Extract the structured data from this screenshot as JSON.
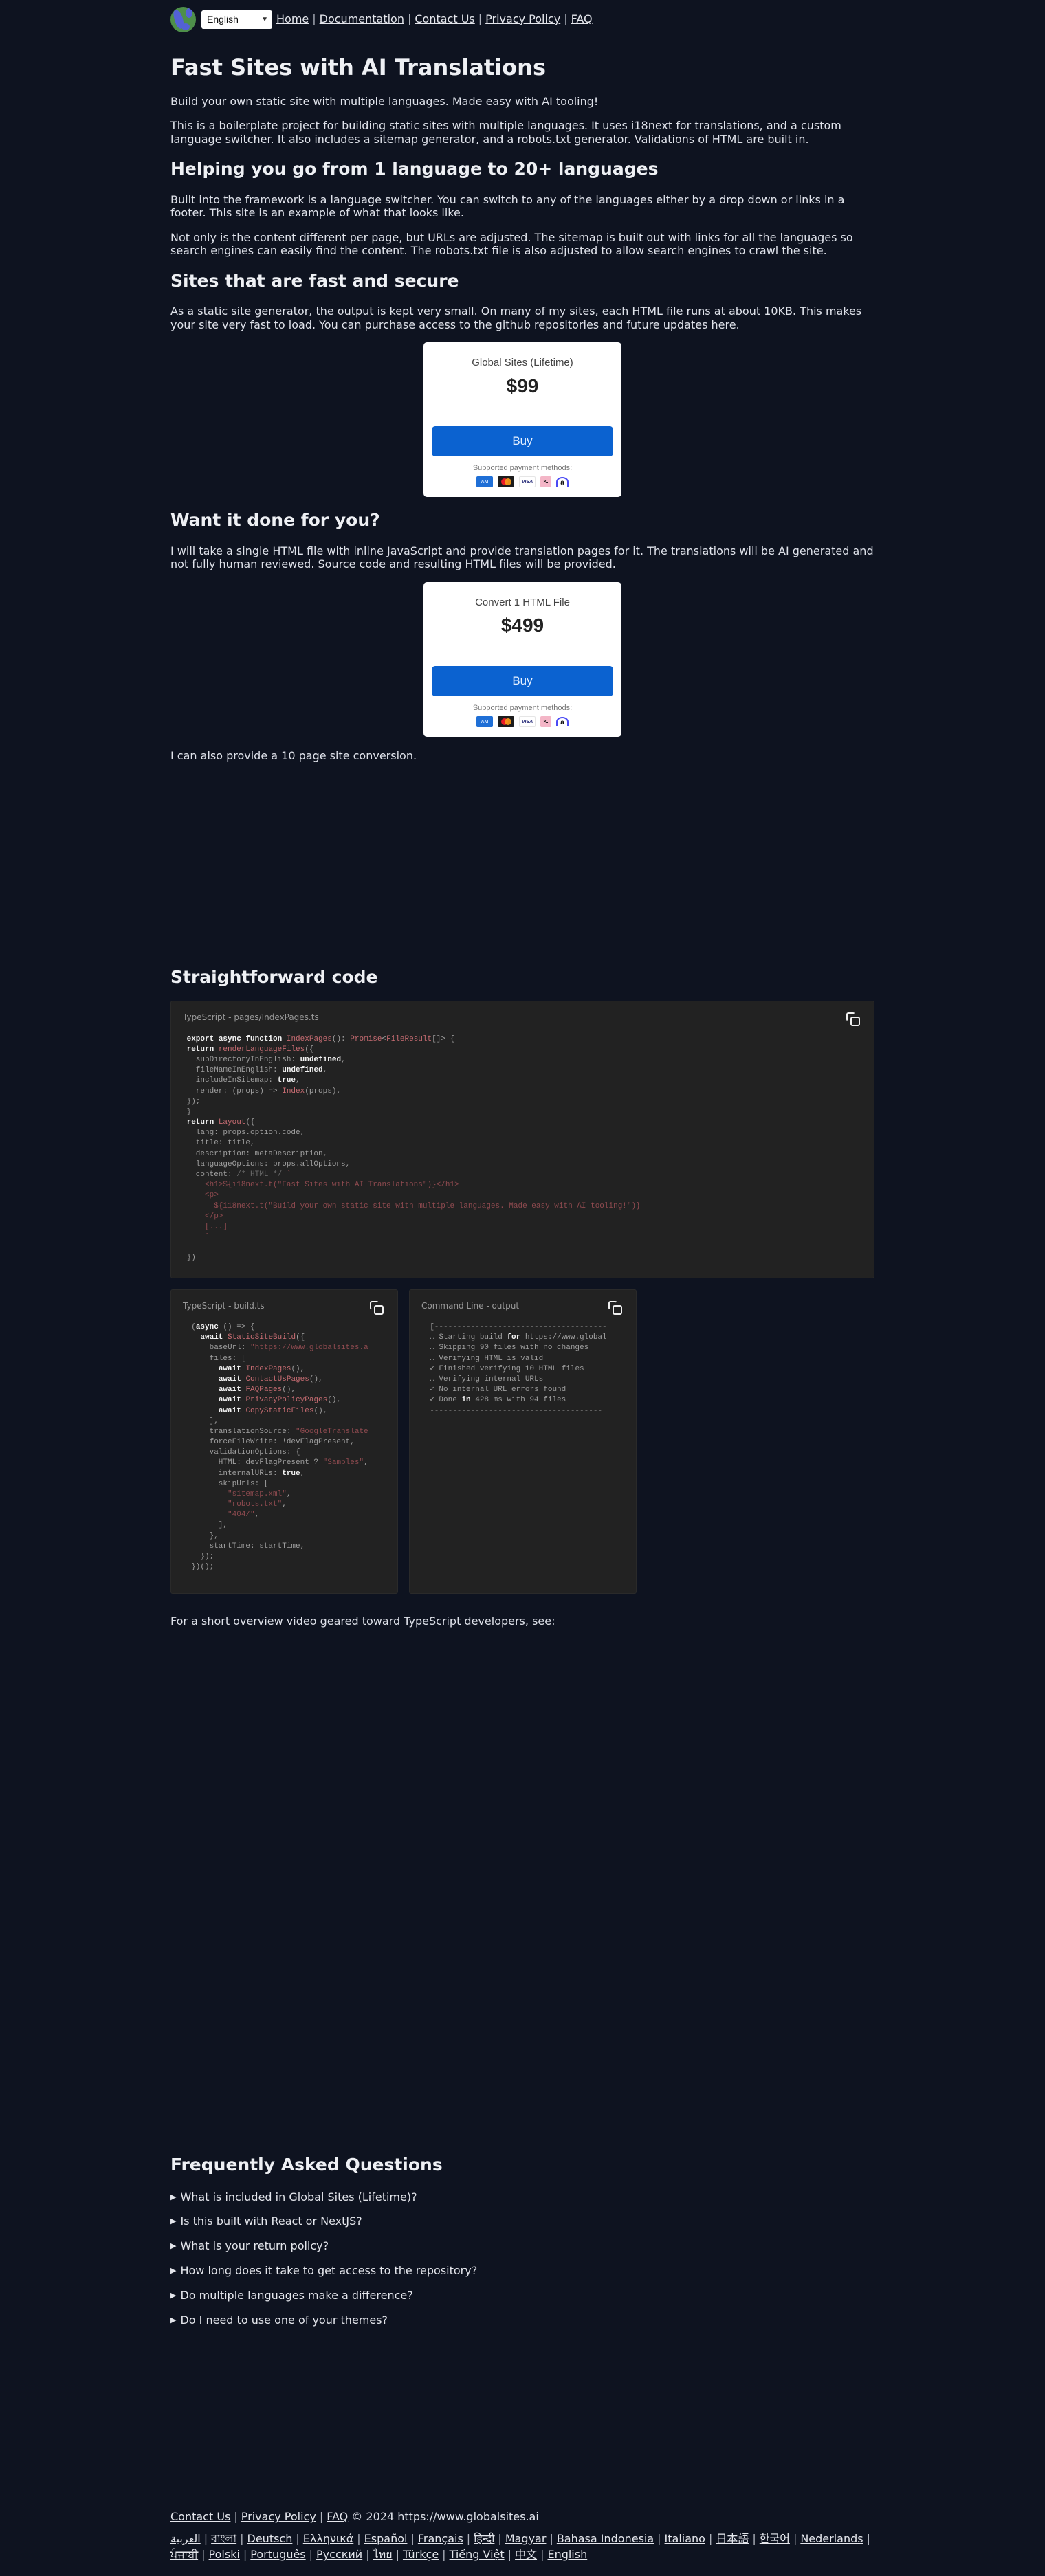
{
  "nav": {
    "globe_icon": "globe-icon",
    "language_select": {
      "value": "English",
      "icon": "chevron-down-icon"
    },
    "links": [
      "Home",
      "Documentation",
      "Contact Us",
      "Privacy Policy",
      "FAQ"
    ],
    "separator": "|"
  },
  "hero": {
    "title": "Fast Sites with AI Translations",
    "subtitle": "Build your own static site with multiple languages. Made easy with AI tooling!",
    "intro": "This is a boilerplate project for building static sites with multiple languages. It uses i18next for translations, and a custom language switcher. It also includes a sitemap generator, and a robots.txt generator. Validations of HTML are built in."
  },
  "languages_section": {
    "heading": "Helping you go from 1 language to 20+ languages",
    "p1": "Built into the framework is a language switcher. You can switch to any of the languages either by a drop down or links in a footer. This site is an example of what that looks like.",
    "p2": "Not only is the content different per page, but URLs are adjusted. The sitemap is built out with links for all the languages so search engines can easily find the content. The robots.txt file is also adjusted to allow search engines to crawl the site."
  },
  "fast_section": {
    "heading": "Sites that are fast and secure",
    "p1": "As a static site generator, the output is kept very small. On many of my sites, each HTML file runs at about 10KB. This makes your site very fast to load. You can purchase access to the github repositories and future updates here."
  },
  "products": [
    {
      "name": "Global Sites (Lifetime)",
      "price": "$99",
      "buy_label": "Buy",
      "payment_label": "Supported payment methods:",
      "payment_methods": [
        "amex-icon",
        "mastercard-icon",
        "visa-icon",
        "klarna-icon",
        "affirm-icon"
      ]
    },
    {
      "name": "Convert 1 HTML File",
      "price": "$499",
      "buy_label": "Buy",
      "payment_label": "Supported payment methods:",
      "payment_methods": [
        "amex-icon",
        "mastercard-icon",
        "visa-icon",
        "klarna-icon",
        "affirm-icon"
      ]
    }
  ],
  "payment_glyphs": {
    "amex": "AM",
    "visa": "VISA",
    "klarna": "K.",
    "affirm": "a"
  },
  "done_section": {
    "heading": "Want it done for you?",
    "p1": "I will take a single HTML file with inline JavaScript and provide translation pages for it. The translations will be AI generated and not fully human reviewed. Source code and resulting HTML files will be provided.",
    "p2": "I can also provide a 10 page site conversion."
  },
  "code_section": {
    "heading": "Straightforward code",
    "blocks": [
      {
        "title": "TypeScript - pages/IndexPages.ts",
        "copy_icon": "copy-icon"
      },
      {
        "title": "TypeScript - build.ts",
        "copy_icon": "copy-icon"
      },
      {
        "title": "Command Line - output",
        "copy_icon": "copy-icon"
      }
    ],
    "video_text": "For a short overview video geared toward TypeScript developers, see:"
  },
  "faq": {
    "heading": "Frequently Asked Questions",
    "items": [
      "What is included in Global Sites (Lifetime)?",
      "Is this built with React or NextJS?",
      "What is your return policy?",
      "How long does it take to get access to the repository?",
      "Do multiple languages make a difference?",
      "Do I need to use one of your themes?"
    ]
  },
  "footer": {
    "links": [
      "Contact Us",
      "Privacy Policy",
      "FAQ"
    ],
    "copyright": "© 2024 https://www.globalsites.ai",
    "languages": [
      "العربية",
      "বাংলা",
      "Deutsch",
      "Ελληνικά",
      "Español",
      "Français",
      "हिन्दी",
      "Magyar",
      "Bahasa Indonesia",
      "Italiano",
      "日本語",
      "한국어",
      "Nederlands",
      "ਪੰਜਾਬੀ",
      "Polski",
      "Português",
      "Русский",
      "ไทย",
      "Türkçe",
      "Tiếng Việt",
      "中文",
      "English"
    ]
  }
}
